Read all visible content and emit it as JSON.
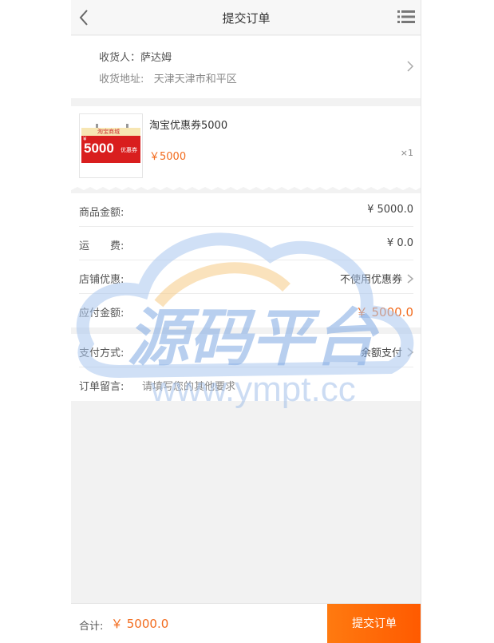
{
  "header": {
    "title": "提交订单"
  },
  "address": {
    "receiver_label": "收货人：",
    "receiver_name": "萨达姆",
    "addr_label": "收货地址:",
    "addr_value": "天津天津市和平区"
  },
  "product": {
    "name": "淘宝优惠券5000",
    "price": "￥5000",
    "qty": "×1",
    "thumb": {
      "band": "淘宝商城",
      "yen": "¥",
      "amount": "5000",
      "tag": "优惠券"
    }
  },
  "rows": {
    "goods_amount": {
      "label": "商品金额:",
      "value": "¥ 5000.0"
    },
    "shipping": {
      "label": "运　　费:",
      "value": "¥ 0.0"
    },
    "shop_discount": {
      "label": "店铺优惠:",
      "value": "不使用优惠券"
    },
    "payable": {
      "label": "应付金额:",
      "value": "￥ 5000.0"
    },
    "pay_method": {
      "label": "支付方式:",
      "value": "余额支付"
    },
    "message": {
      "label": "订单留言:",
      "placeholder": "请填写您的其他要求"
    }
  },
  "footer": {
    "total_label": "合计:",
    "total_value": "￥ 5000.0",
    "submit_label": "提交订单"
  },
  "watermark": {
    "text": "源码平台",
    "url": "www.ympt.cc"
  },
  "colors": {
    "accent": "#f26b1d",
    "submit": "#ff6a00"
  }
}
